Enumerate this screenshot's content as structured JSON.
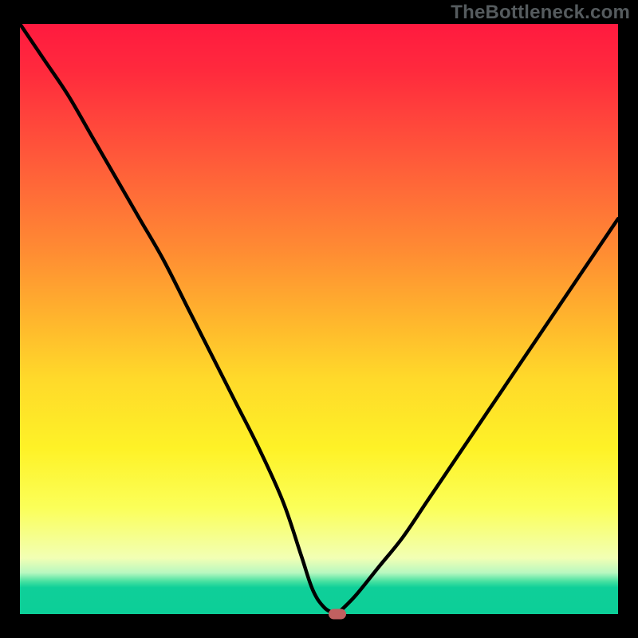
{
  "attribution": "TheBottleneck.com",
  "colors": {
    "frame": "#000000",
    "curve": "#000000",
    "marker": "#c06060",
    "gradient_stops": [
      "#ff1a3f",
      "#ff2a3d",
      "#ff4a3b",
      "#ff6a38",
      "#ff8a33",
      "#ffb52d",
      "#ffd92a",
      "#fef227",
      "#fbff59",
      "#f2ffb4",
      "#b8f8c0",
      "#44e0a0",
      "#0fcf99",
      "#0ccf98"
    ]
  },
  "chart_data": {
    "type": "line",
    "title": "",
    "xlabel": "",
    "ylabel": "",
    "xlim": [
      0,
      100
    ],
    "ylim": [
      0,
      100
    ],
    "grid": false,
    "series": [
      {
        "name": "bottleneck-curve-left",
        "x": [
          0,
          4,
          8,
          12,
          16,
          20,
          24,
          28,
          32,
          36,
          40,
          44,
          47,
          49,
          51,
          53
        ],
        "values": [
          100,
          94,
          88,
          81,
          74,
          67,
          60,
          52,
          44,
          36,
          28,
          19,
          10,
          4,
          1,
          0
        ]
      },
      {
        "name": "bottleneck-curve-right",
        "x": [
          53,
          56,
          60,
          64,
          68,
          72,
          76,
          80,
          84,
          88,
          92,
          96,
          100
        ],
        "values": [
          0,
          3,
          8,
          13,
          19,
          25,
          31,
          37,
          43,
          49,
          55,
          61,
          67
        ]
      }
    ],
    "minimum_point": {
      "x": 53,
      "y": 0
    },
    "annotations": []
  }
}
